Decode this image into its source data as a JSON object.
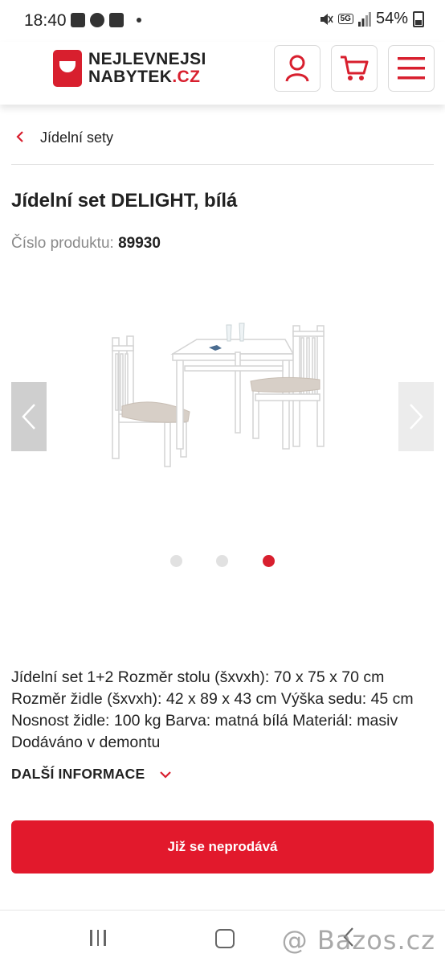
{
  "status_bar": {
    "time": "18:40",
    "five_g": "5G",
    "battery": "54%"
  },
  "header": {
    "logo_line1": "NEJLEVNEJSI",
    "logo_line2": "NABYTEK",
    "logo_suffix": ".CZ"
  },
  "breadcrumb": {
    "label": "Jídelní sety"
  },
  "product": {
    "title": "Jídelní set DELIGHT, bílá",
    "number_label": "Číslo produktu:",
    "number_value": "89930",
    "description": "Jídelní set 1+2 Rozměr stolu (šxvxh): 70 x 75 x 70 cm Rozměr židle (šxvxh): 42 x 89 x 43 cm Výška sedu: 45 cm Nosnost židle: 100 kg Barva: matná bílá Materiál: masiv Dodáváno v demontu",
    "more_info_label": "DALŠÍ INFORMACE",
    "cta_label": "Již se neprodává"
  },
  "gallery": {
    "image_count": 3,
    "active_index": 3
  },
  "watermark": "@ Bazos.cz",
  "colors": {
    "brand_red": "#d81f2e",
    "cta_red": "#e2192c"
  }
}
